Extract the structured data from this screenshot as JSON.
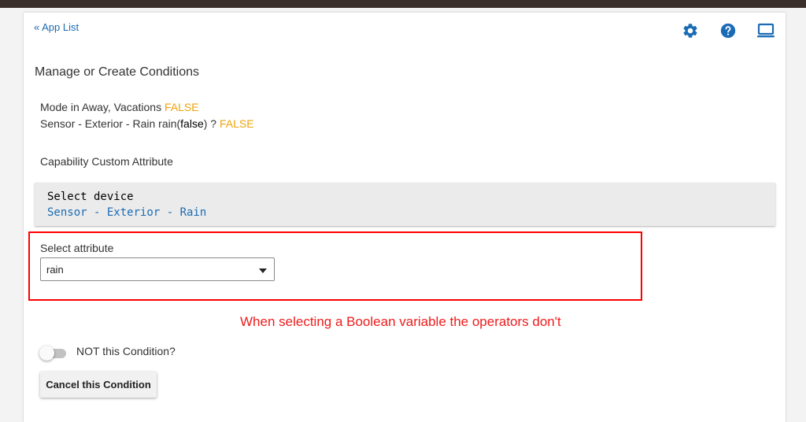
{
  "nav": {
    "back_link": "« App List"
  },
  "header_icons": [
    "gear-icon",
    "help-icon",
    "laptop-icon"
  ],
  "page": {
    "heading": "Manage or Create Conditions"
  },
  "conditions": [
    {
      "text": "Mode in Away, Vacations",
      "result": "FALSE"
    },
    {
      "prefix": "Sensor - Exterior - Rain rain(",
      "value": "false",
      "suffix": ") ?",
      "result": "FALSE"
    }
  ],
  "capability": {
    "label": "Capability Custom Attribute"
  },
  "device": {
    "label": "Select device",
    "value": "Sensor - Exterior - Rain"
  },
  "attribute": {
    "label": "Select attribute",
    "selected": "rain"
  },
  "annotation": {
    "text": "When selecting a Boolean variable the operators don't"
  },
  "not_toggle": {
    "label": "NOT this Condition?",
    "checked": false
  },
  "cancel_button": {
    "label": "Cancel this Condition"
  },
  "colors": {
    "accent_blue": "#1a6bb5",
    "false_orange": "#f0a30a",
    "annotation_red": "#ee1c1c",
    "highlight_red": "#ff0000",
    "topbar": "#3a2f2b"
  }
}
